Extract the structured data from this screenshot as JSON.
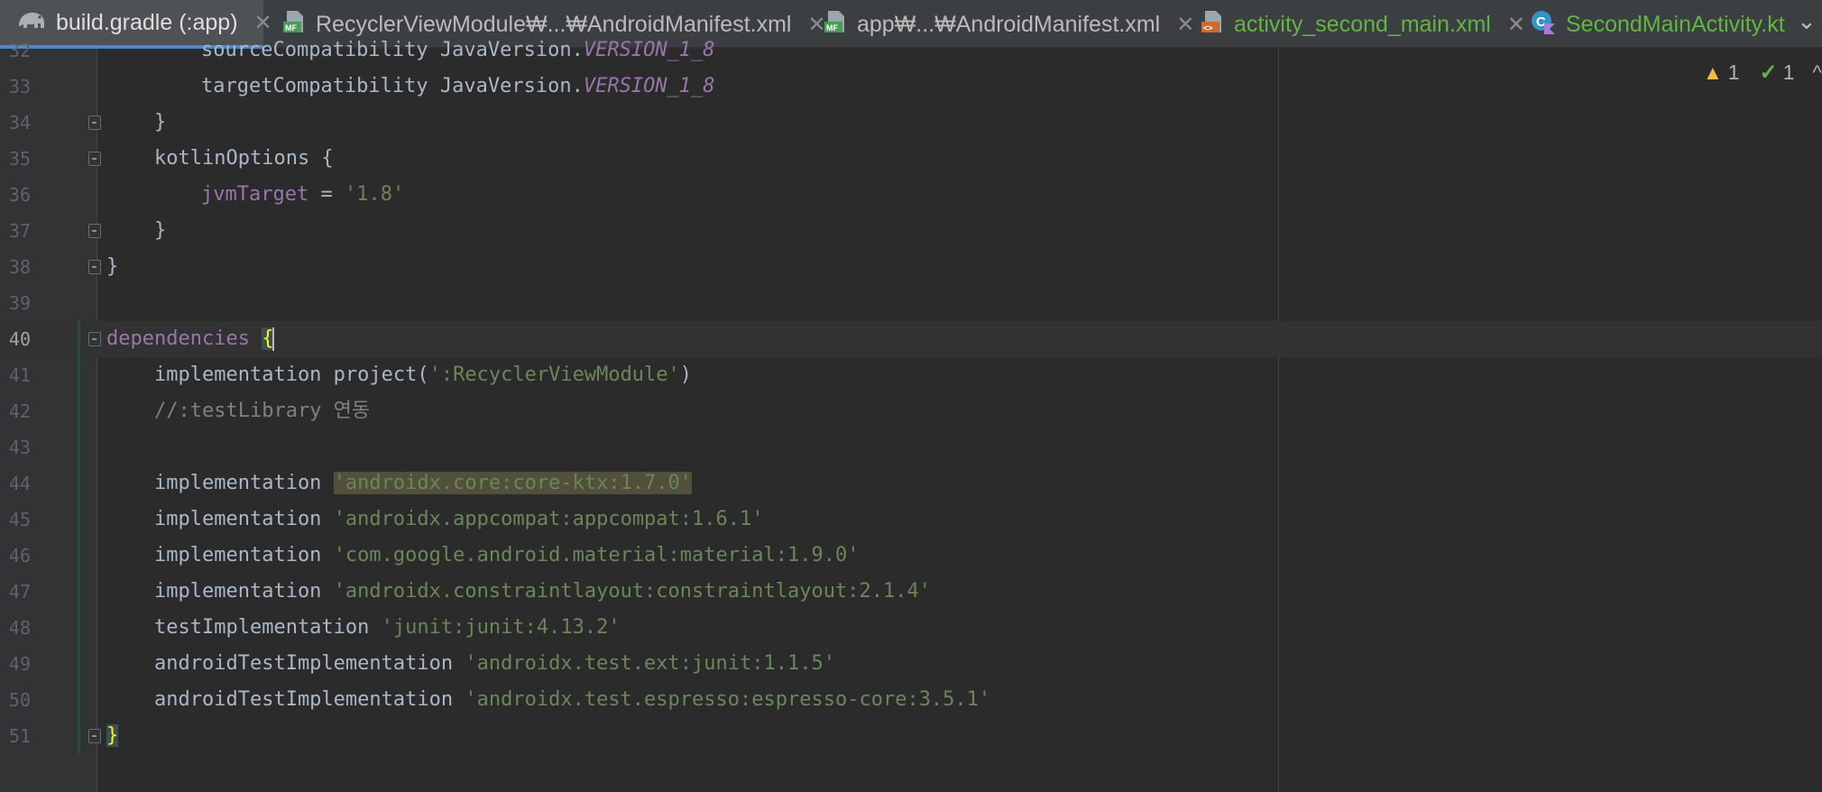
{
  "tabs": [
    {
      "label": "build.gradle (:app)",
      "icon": "gradle-elephant-icon",
      "active": true
    },
    {
      "label": "RecyclerViewModule₩...₩AndroidManifest.xml",
      "icon": "manifest-file-icon"
    },
    {
      "label": "app₩...₩AndroidManifest.xml",
      "icon": "manifest-file-icon"
    },
    {
      "label": "activity_second_main.xml",
      "icon": "layout-xml-icon",
      "modified": true
    },
    {
      "label": "SecondMainActivity.kt",
      "icon": "kotlin-class-icon",
      "modified": true
    }
  ],
  "inspection": {
    "warnings": "1",
    "weak_warnings": "1"
  },
  "editor": {
    "line_numbers": [
      "32",
      "33",
      "34",
      "35",
      "36",
      "37",
      "38",
      "39",
      "40",
      "41",
      "42",
      "43",
      "44",
      "45",
      "46",
      "47",
      "48",
      "49",
      "50",
      "51"
    ],
    "current_line": "40",
    "code": {
      "l32_a": "sourceCompatibility JavaVersion.",
      "l32_b": "VERSION_1_8",
      "l33_a": "targetCompatibility JavaVersion.",
      "l33_b": "VERSION_1_8",
      "l34": "}",
      "l35": "kotlinOptions {",
      "l36_a": "jvmTarget",
      "l36_b": " = ",
      "l36_c": "'1.8'",
      "l37": "}",
      "l38": "}",
      "l40_a": "dependencies",
      "l40_b": " ",
      "l40_c": "{",
      "l41_a": "implementation project(",
      "l41_b": "':RecyclerViewModule'",
      "l41_c": ")",
      "l42": "//:testLibrary 연동",
      "l44_a": "implementation ",
      "l44_b": "'androidx.core:core-ktx:1.7.0'",
      "l45_a": "implementation ",
      "l45_b": "'androidx.appcompat:appcompat:1.6.1'",
      "l46_a": "implementation ",
      "l46_b": "'com.google.android.material:material:1.9.0'",
      "l47_a": "implementation ",
      "l47_b": "'androidx.constraintlayout:constraintlayout:2.1.4'",
      "l48_a": "testImplementation ",
      "l48_b": "'junit:junit:4.13.2'",
      "l49_a": "androidTestImplementation ",
      "l49_b": "'androidx.test.ext:junit:1.1.5'",
      "l50_a": "androidTestImplementation ",
      "l50_b": "'androidx.test.espresso:espresso-core:3.5.1'",
      "l51": "}"
    }
  },
  "colors": {
    "background": "#2b2b2b",
    "gutter": "#313335",
    "string": "#6a8759",
    "property": "#9876aa",
    "default_text": "#a9b7c6",
    "comment": "#808080",
    "brace_highlight": "#ffef28"
  }
}
